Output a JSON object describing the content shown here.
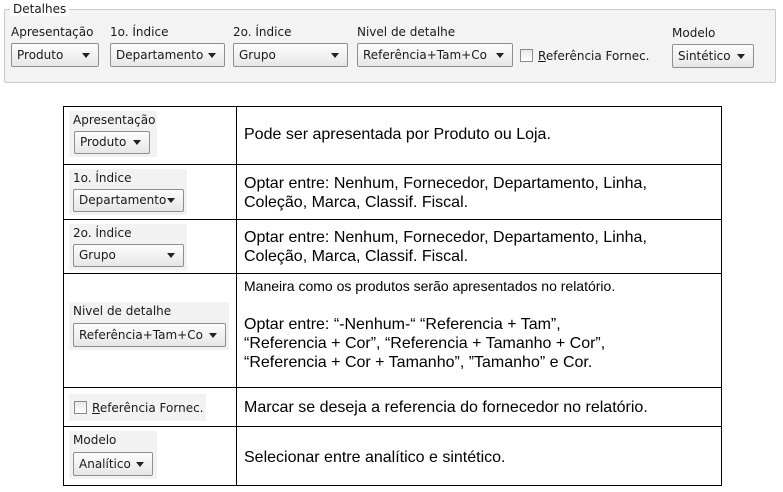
{
  "toolbar": {
    "group_title": "Detalhes",
    "apresentacao": {
      "label": "Apresentação",
      "value": "Produto"
    },
    "indice1": {
      "label": "1o. Índice",
      "value": "Departamento"
    },
    "indice2": {
      "label": "2o. Índice",
      "value": "Grupo"
    },
    "nivel": {
      "label": "Nivel de detalhe",
      "value": "Referência+Tam+Co"
    },
    "ref_fornec": {
      "label_underlined": "R",
      "label_rest": "eferência Fornec.",
      "checked": false
    },
    "modelo": {
      "label": "Modelo",
      "value": "Sintético"
    }
  },
  "table": {
    "rows": [
      {
        "snip_label": "Apresentação",
        "snip_value": "Produto",
        "description": [
          "Pode ser apresentada por Produto ou Loja."
        ]
      },
      {
        "snip_label": "1o. Índice",
        "snip_value": "Departamento",
        "description": [
          "Optar entre: Nenhum, Fornecedor, Departamento, Linha,",
          "Coleção, Marca, Classif. Fiscal."
        ]
      },
      {
        "snip_label": "2o. Índice",
        "snip_value": "Grupo",
        "description": [
          "Optar entre: Nenhum, Fornecedor, Departamento, Linha,",
          "Coleção, Marca, Classif. Fiscal."
        ]
      },
      {
        "snip_label": "Nivel de detalhe",
        "snip_value": "Referência+Tam+Co",
        "note": "Maneira como os produtos serão apresentados no relatório.",
        "description": [
          "Optar entre: “-Nenhum-“ “Referencia + Tam”,",
          "“Referencia + Cor”, “Referencia + Tamanho + Cor”,",
          "“Referencia + Cor + Tamanho”, ”Tamanho” e Cor."
        ]
      },
      {
        "snip_check_underlined": "R",
        "snip_check_rest": "eferência Fornec.",
        "description": [
          "Marcar se deseja a referencia do fornecedor no relatório."
        ]
      },
      {
        "snip_label": "Modelo",
        "snip_value": "Analítico",
        "description": [
          "Selecionar entre analítico e sintético."
        ]
      }
    ]
  }
}
